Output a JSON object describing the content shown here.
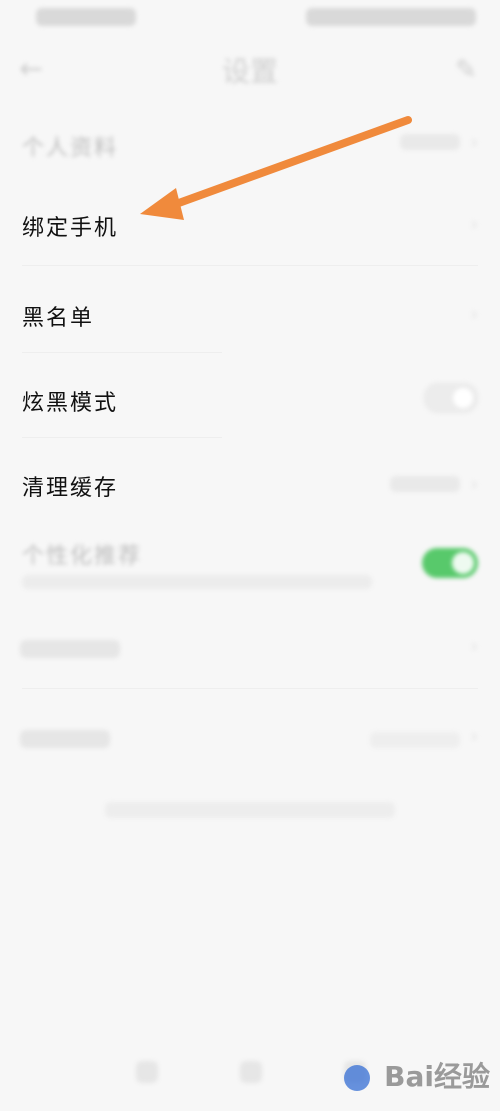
{
  "header": {
    "title": "设置"
  },
  "rows": [
    {
      "label": "个人资料",
      "faded": true
    },
    {
      "label": "绑定手机"
    },
    {
      "label": "黑名单"
    },
    {
      "label": "炫黑模式"
    },
    {
      "label": "清理缓存"
    },
    {
      "label": "个性化推荐",
      "faded": true
    }
  ],
  "watermark": "Bai经验",
  "colors": {
    "arrow": "#f08a3c",
    "toggle_on": "#58c96b",
    "background": "#f7f7f7"
  }
}
